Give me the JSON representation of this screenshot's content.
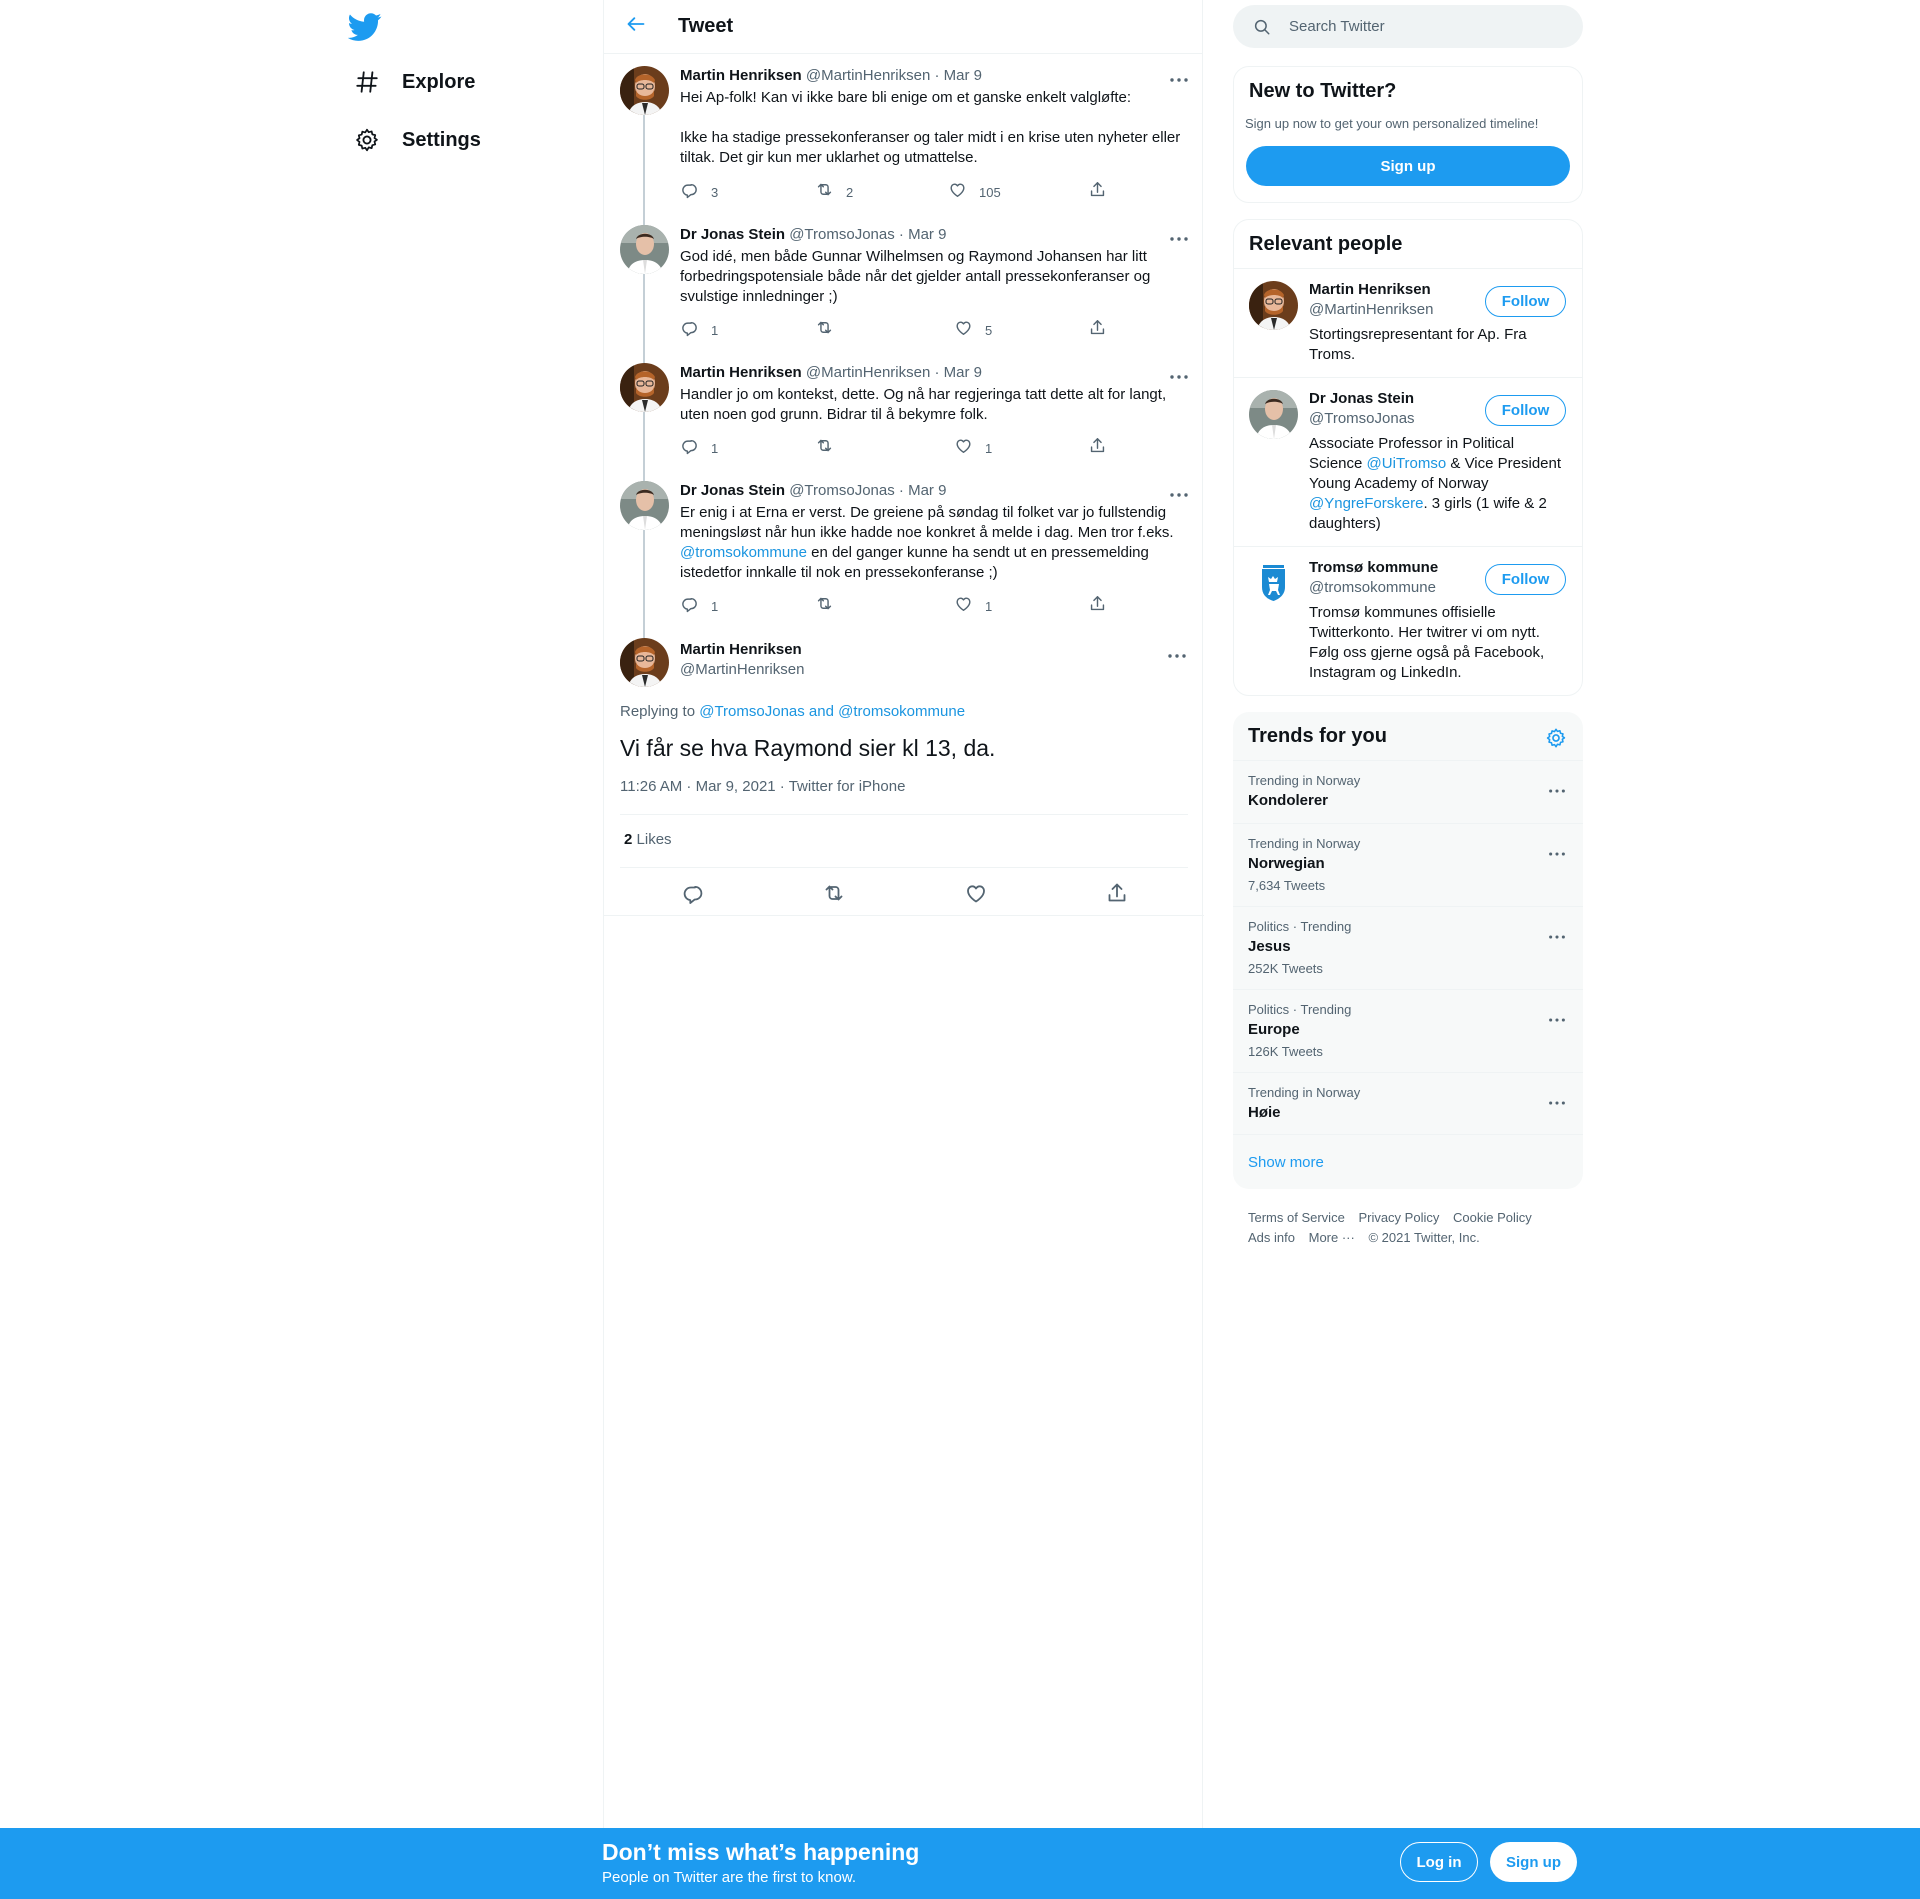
{
  "colors": {
    "brand": "#1d9bf0",
    "text": "#0f1419",
    "muted": "#536471",
    "link": "#1b95e0"
  },
  "nav": {
    "logo_icon": "twitter-bird-icon",
    "items": [
      {
        "label": "Explore",
        "icon": "hashtag-icon"
      },
      {
        "label": "Settings",
        "icon": "gear-icon"
      }
    ]
  },
  "header": {
    "title": "Tweet",
    "back_icon": "arrow-left-icon"
  },
  "thread": [
    {
      "name": "Martin Henriksen",
      "handle": "@MartinHenriksen",
      "date": "Mar 9",
      "text": "Hei Ap-folk! Kan vi ikke bare bli enige om et ganske enkelt valgløfte:\n\nIkke ha stadige pressekonferanser og taler midt i en krise uten nyheter eller tiltak. Det gir kun mer uklarhet og utmattelse.",
      "replies": "3",
      "retweets": "2",
      "likes": "105"
    },
    {
      "name": "Dr Jonas Stein",
      "handle": "@TromsoJonas",
      "date": "Mar 9",
      "text": "God idé, men både Gunnar Wilhelmsen og Raymond Johansen har litt forbedringspotensiale både når det gjelder antall pressekonferanser og svulstige innledninger ;)",
      "replies": "1",
      "retweets": "",
      "likes": "5"
    },
    {
      "name": "Martin Henriksen",
      "handle": "@MartinHenriksen",
      "date": "Mar 9",
      "text": "Handler jo om kontekst, dette. Og nå har regjeringa tatt dette alt for langt, uten noen god grunn. Bidrar til å bekymre folk.",
      "replies": "1",
      "retweets": "",
      "likes": "1"
    },
    {
      "name": "Dr Jonas Stein",
      "handle": "@TromsoJonas",
      "date": "Mar 9",
      "text_before": "Er enig i at Erna er verst. De greiene på søndag til folket var jo fullstendig meningsløst når hun ikke hadde noe konkret å melde i dag. Men tror f.eks.",
      "text_mention": "@tromsokommune",
      "text_after": " en del ganger kunne ha sendt ut en pressemelding istedetfor innkalle til nok en pressekonferanse ;)",
      "replies": "1",
      "retweets": "",
      "likes": "1"
    }
  ],
  "main_tweet": {
    "name": "Martin Henriksen",
    "handle": "@MartinHenriksen",
    "replying_prefix": "Replying to",
    "replying_to": "@TromsoJonas and @tromsokommune",
    "text": "Vi får se hva Raymond sier kl 13, da.",
    "meta": "11:26 AM · Mar 9, 2021 · Twitter for iPhone",
    "likes_count": "2",
    "likes_label": "Likes"
  },
  "search": {
    "placeholder": "Search Twitter"
  },
  "signup_card": {
    "title": "New to Twitter?",
    "subtitle": "Sign up now to get your own personalized timeline!",
    "button": "Sign up"
  },
  "relevant_people": {
    "title": "Relevant people",
    "follow_label": "Follow",
    "people": [
      {
        "name": "Martin Henriksen",
        "handle": "@MartinHenriksen",
        "bio": "Stortingsrepresentant for Ap. Fra Troms."
      },
      {
        "name": "Dr Jonas Stein",
        "handle": "@TromsoJonas",
        "bio_1": "Associate Professor in Political Science ",
        "bio_m1": "@UiTromso",
        "bio_2": " & Vice President Young Academy of Norway ",
        "bio_m2": "@YngreForskere",
        "bio_3": ". 3 girls (1 wife & 2 daughters)"
      },
      {
        "name": "Tromsø kommune",
        "handle": "@tromsokommune",
        "bio": "Tromsø kommunes offisielle Twitterkonto. Her twitrer vi om nytt. Følg oss gjerne også på Facebook, Instagram og LinkedIn."
      }
    ]
  },
  "trends": {
    "title": "Trends for you",
    "items": [
      {
        "meta": "Trending in Norway",
        "name": "Kondolerer",
        "count": ""
      },
      {
        "meta": "Trending in Norway",
        "name": "Norwegian",
        "count": "7,634 Tweets"
      },
      {
        "meta": "Politics · Trending",
        "name": "Jesus",
        "count": "252K Tweets"
      },
      {
        "meta": "Politics · Trending",
        "name": "Europe",
        "count": "126K Tweets"
      },
      {
        "meta": "Trending in Norway",
        "name": "Høie",
        "count": ""
      }
    ],
    "show_more": "Show more"
  },
  "footer": {
    "terms": "Terms of Service",
    "privacy": "Privacy Policy",
    "cookie": "Cookie Policy",
    "ads": "Ads info",
    "more": "More ···",
    "copyright": "© 2021 Twitter, Inc."
  },
  "bottom_bar": {
    "title": "Don’t miss what’s happening",
    "subtitle": "People on Twitter are the first to know.",
    "login": "Log in",
    "signup": "Sign up"
  }
}
